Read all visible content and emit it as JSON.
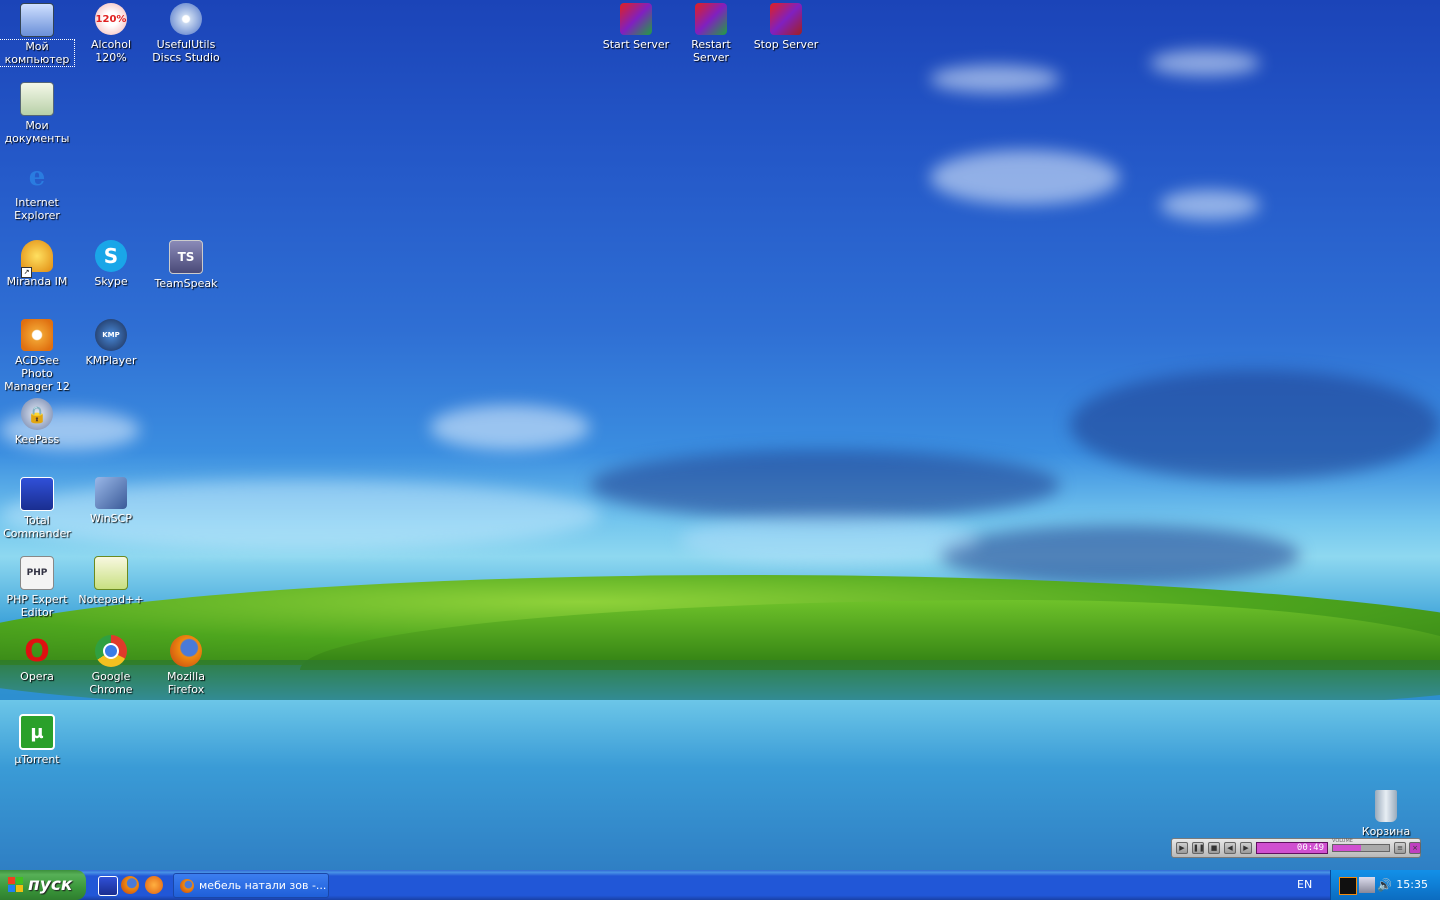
{
  "desktop": {
    "icons": [
      {
        "label": "Мой компьютер",
        "icon": "my-computer-icon"
      },
      {
        "label": "Alcohol 120%",
        "icon": "alcohol-icon",
        "badge": "120%"
      },
      {
        "label": "UsefulUtils Discs Studio",
        "icon": "discs-studio-icon"
      },
      {
        "label": "Start Server",
        "icon": "start-server-icon"
      },
      {
        "label": "Restart Server",
        "icon": "restart-server-icon"
      },
      {
        "label": "Stop Server",
        "icon": "stop-server-icon"
      },
      {
        "label": "Мои документы",
        "icon": "my-documents-icon"
      },
      {
        "label": "Internet Explorer",
        "icon": "internet-explorer-icon"
      },
      {
        "label": "Miranda IM",
        "icon": "miranda-icon"
      },
      {
        "label": "Skype",
        "icon": "skype-icon",
        "badge": "S"
      },
      {
        "label": "TeamSpeak",
        "icon": "teamspeak-icon",
        "badge": "TS"
      },
      {
        "label": "ACDSee Photo Manager 12",
        "icon": "acdsee-icon"
      },
      {
        "label": "KMPlayer",
        "icon": "kmplayer-icon",
        "badge": "KMP"
      },
      {
        "label": "KeePass",
        "icon": "keepass-icon"
      },
      {
        "label": "Total Commander",
        "icon": "total-commander-icon"
      },
      {
        "label": "WinSCP",
        "icon": "winscp-icon"
      },
      {
        "label": "PHP Expert Editor",
        "icon": "php-editor-icon",
        "badge": "PHP"
      },
      {
        "label": "Notepad++",
        "icon": "notepadpp-icon"
      },
      {
        "label": "Opera",
        "icon": "opera-icon",
        "badge": "O"
      },
      {
        "label": "Google Chrome",
        "icon": "chrome-icon"
      },
      {
        "label": "Mozilla Firefox",
        "icon": "firefox-icon"
      },
      {
        "label": "µTorrent",
        "icon": "utorrent-icon",
        "badge": "µ"
      },
      {
        "label": "Корзина",
        "icon": "recycle-bin-icon"
      }
    ]
  },
  "taskbar": {
    "start_label": "пуск",
    "quick_launch": [
      "total-commander-icon",
      "firefox-icon",
      "avast-icon"
    ],
    "task_button": "мебель натали зов -...",
    "language": "EN",
    "clock": "15:35"
  },
  "player": {
    "time": "00:49",
    "volume_label": "VOLUME",
    "volume": 0.5
  },
  "colors": {
    "taskbar": "#2157d7",
    "start_button": "#3a973a",
    "tray": "#0f7fd6",
    "player_display": "#d050d0"
  }
}
